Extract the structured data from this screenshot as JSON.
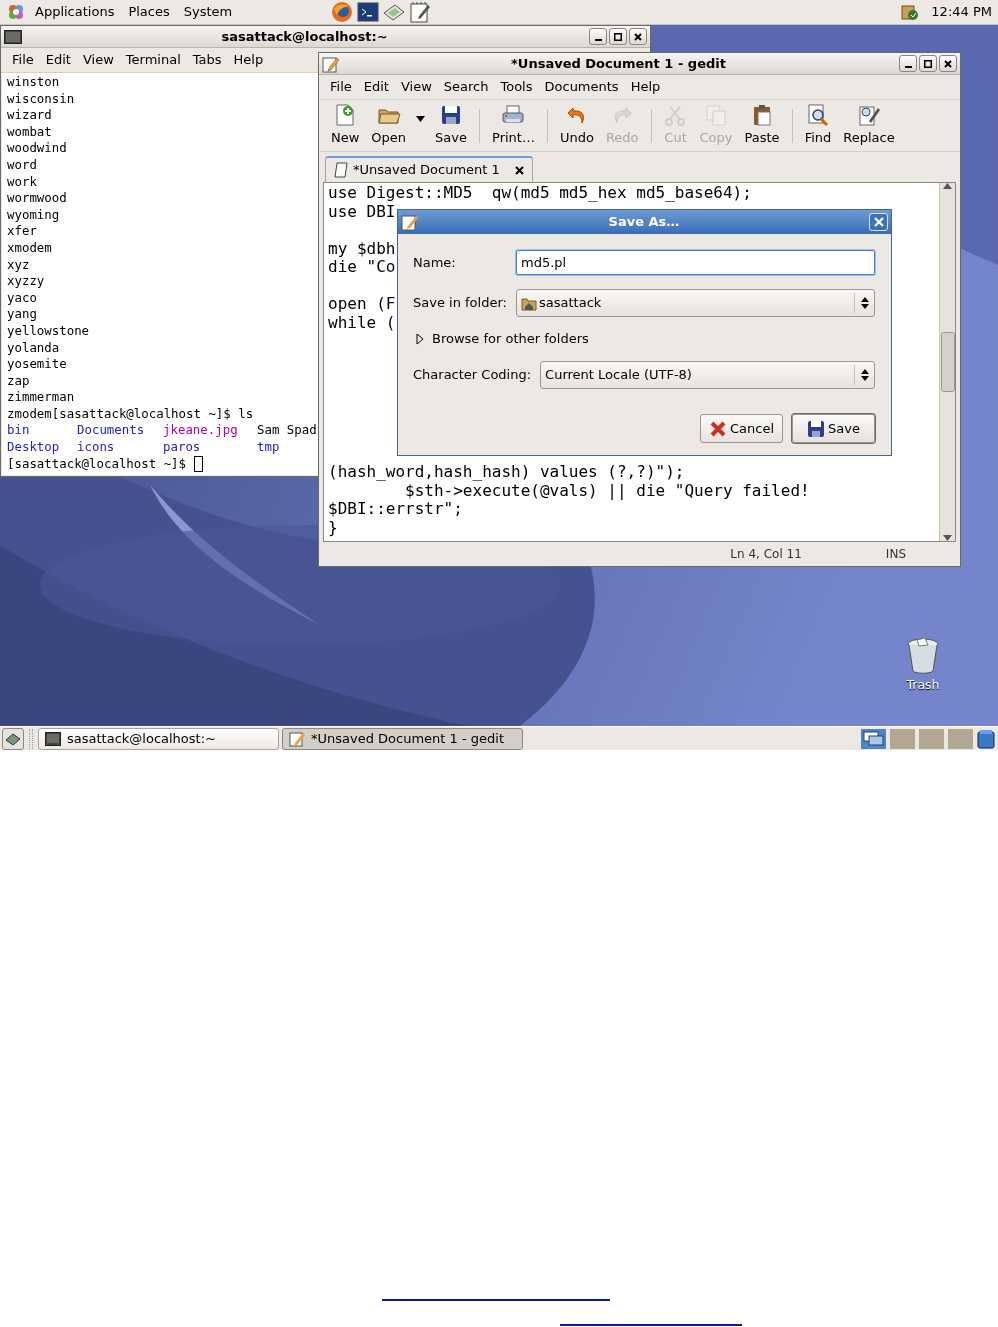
{
  "top_panel": {
    "menus": [
      {
        "label": "Applications"
      },
      {
        "label": "Places"
      },
      {
        "label": "System"
      }
    ],
    "clock": "12:44 PM"
  },
  "terminal": {
    "title": "sasattack@localhost:~",
    "menu": [
      "File",
      "Edit",
      "View",
      "Terminal",
      "Tabs",
      "Help"
    ],
    "lines": [
      "winston",
      "wisconsin",
      "wizard",
      "wombat",
      "woodwind",
      "word",
      "work",
      "wormwood",
      "wyoming",
      "xfer",
      "xmodem",
      "xyz",
      "xyzzy",
      "yaco",
      "yang",
      "yellowstone",
      "yolanda",
      "yosemite",
      "zap",
      "zimmerman",
      "zmodem[sasattack@localhost ~]$ ls"
    ],
    "listing": [
      [
        {
          "name": "bin",
          "kind": "dir"
        },
        {
          "name": "Documents",
          "kind": "dir"
        },
        {
          "name": "jkeane.jpg"
        },
        {
          "name": "Sam Spad",
          "kind": "file"
        }
      ],
      [
        {
          "name": "Desktop",
          "kind": "dir"
        },
        {
          "name": "icons",
          "kind": "dir"
        },
        {
          "name": "paros",
          "kind": "dir"
        },
        {
          "name": "tmp",
          "kind": "dir"
        }
      ]
    ],
    "prompt": "[sasattack@localhost ~]$ "
  },
  "gedit": {
    "title": "*Unsaved Document 1 - gedit",
    "menu": [
      "File",
      "Edit",
      "View",
      "Search",
      "Tools",
      "Documents",
      "Help"
    ],
    "toolbar": [
      [
        {
          "label": "New",
          "disabled": false
        },
        {
          "label": "Open",
          "disabled": false
        },
        {
          "label": "Save",
          "disabled": false
        }
      ],
      [
        {
          "label": "Print…",
          "disabled": false
        }
      ],
      [
        {
          "label": "Undo",
          "disabled": false
        },
        {
          "label": "Redo",
          "disabled": true
        }
      ],
      [
        {
          "label": "Cut",
          "disabled": true
        },
        {
          "label": "Copy",
          "disabled": true
        },
        {
          "label": "Paste",
          "disabled": false
        }
      ],
      [
        {
          "label": "Find",
          "disabled": false
        },
        {
          "label": "Replace",
          "disabled": false
        }
      ]
    ],
    "tabs": [
      {
        "label": "*Unsaved Document 1",
        "selected": true
      }
    ],
    "code_blocks": [
      [
        "use Digest::MD5  qw(md5 md5_hex md5_base64);",
        "use DBI"
      ],
      [
        "my $dbh",
        "die \"Co"
      ],
      [
        "open (F",
        "while ("
      ],
      [
        "(hash_word,hash_hash) values (?,?)\");",
        "        $sth->execute(@vals) || die \"Query failed!",
        "$DBI::errstr\";",
        "}"
      ]
    ],
    "status": {
      "position": "Ln 4, Col 11",
      "mode": "INS"
    }
  },
  "dialog": {
    "title": "Save As…",
    "name_label": "Name:",
    "name_value": "md5.pl",
    "folder_label": "Save in folder:",
    "folder_value": "sasattack",
    "browse": {
      "label": "Browse for other folders",
      "expanded": false
    },
    "coding_label": "Character Coding:",
    "coding_value": "Current Locale (UTF-8)",
    "buttons": [
      {
        "label": "Cancel",
        "kind": "cancel",
        "default": false
      },
      {
        "label": "Save",
        "kind": "save",
        "default": true
      }
    ]
  },
  "desktop": {
    "icons": [
      {
        "label": "Trash"
      }
    ]
  },
  "taskbar": {
    "tasks": [
      {
        "label": "sasattack@localhost:~",
        "kind": "terminal",
        "selected": false
      },
      {
        "label": "*Unsaved Document 1 - gedit",
        "kind": "editor",
        "selected": true
      }
    ],
    "workspaces": [
      {
        "selected": true
      },
      {
        "selected": false
      },
      {
        "selected": false
      },
      {
        "selected": false
      }
    ]
  }
}
